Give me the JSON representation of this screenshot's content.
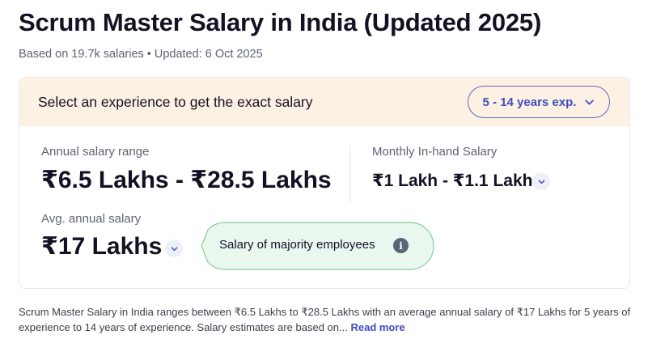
{
  "header": {
    "title": "Scrum Master Salary in India (Updated 2025)",
    "meta_based_on": "Based on 19.7k salaries",
    "meta_separator": "•",
    "meta_updated": "Updated: 6 Oct 2025"
  },
  "card": {
    "prompt": "Select an experience to get the exact salary",
    "experience_select": {
      "selected": "5 - 14 years exp.",
      "icon": "chevron-down-icon"
    },
    "annual_range": {
      "label": "Annual salary range",
      "value": "₹6.5 Lakhs - ₹28.5 Lakhs"
    },
    "monthly_inhand": {
      "label": "Monthly In-hand Salary",
      "value": "₹1 Lakh - ₹1.1 Lakh",
      "icon": "chevron-down-icon"
    },
    "average": {
      "label": "Avg. annual salary",
      "value": "₹17 Lakhs",
      "icon": "chevron-down-icon"
    },
    "majority_tooltip": {
      "text": "Salary of majority employees",
      "icon": "info-icon",
      "icon_glyph": "i",
      "fill_color": "#eaf7ef",
      "border_color": "#7fcf9c"
    }
  },
  "description": {
    "text": "Scrum Master Salary in India ranges between ₹6.5 Lakhs to ₹28.5 Lakhs with an average annual salary of ₹17 Lakhs for 5 years of experience to 14 years of experience. Salary estimates are based on...",
    "read_more": "Read more"
  },
  "colors": {
    "accent": "#3e4cc0",
    "header_band": "#fdf1e3",
    "text_primary": "#121224",
    "text_secondary": "#5e6375"
  }
}
